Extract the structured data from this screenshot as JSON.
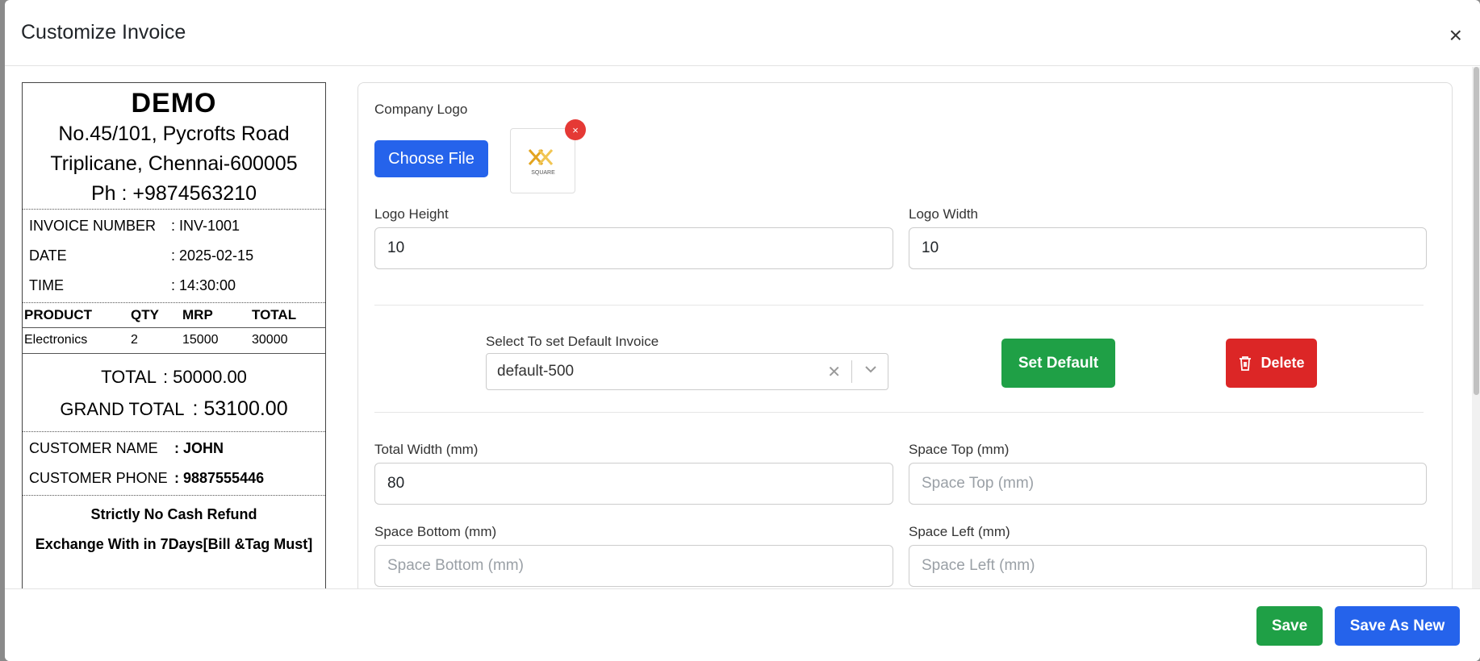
{
  "modal": {
    "title": "Customize Invoice",
    "close_glyph": "×"
  },
  "receipt": {
    "company": "DEMO",
    "address1": "No.45/101, Pycrofts Road",
    "address2": "Triplicane, Chennai-600005",
    "phone": "Ph : +9874563210",
    "info": [
      {
        "k": "INVOICE NUMBER",
        "v": ": INV-1001"
      },
      {
        "k": "DATE",
        "v": ": 2025-02-15"
      },
      {
        "k": "TIME",
        "v": ": 14:30:00"
      }
    ],
    "table": {
      "headers": [
        "PRODUCT",
        "QTY",
        "MRP",
        "TOTAL"
      ],
      "rows": [
        [
          "Electronics",
          "2",
          "15000",
          "30000"
        ]
      ]
    },
    "total_label": "TOTAL",
    "total_value": ": 50000.00",
    "grand_total_label": "GRAND TOTAL",
    "grand_total_value": ": 53100.00",
    "customer": [
      {
        "k": "CUSTOMER NAME",
        "v": ": JOHN"
      },
      {
        "k": "CUSTOMER PHONE",
        "v": ": 9887555446"
      }
    ],
    "notes": [
      "Strictly No Cash Refund",
      "Exchange With in 7Days[Bill &Tag Must]"
    ]
  },
  "form": {
    "company_logo_label": "Company Logo",
    "choose_file_label": "Choose File",
    "logo_remove_glyph": "×",
    "logo_text": "SQUARE",
    "logo_height_label": "Logo Height",
    "logo_height_value": "10",
    "logo_width_label": "Logo Width",
    "logo_width_value": "10",
    "default_select_label": "Select To set Default Invoice",
    "default_select_value": "default-500",
    "set_default_label": "Set Default",
    "delete_label": "Delete",
    "total_width_label": "Total Width (mm)",
    "total_width_value": "80",
    "space_top_label": "Space Top (mm)",
    "space_top_placeholder": "Space Top (mm)",
    "space_bottom_label": "Space Bottom (mm)",
    "space_bottom_placeholder": "Space Bottom (mm)",
    "space_left_label": "Space Left (mm)",
    "space_left_placeholder": "Space Left (mm)"
  },
  "footer": {
    "save_label": "Save",
    "save_as_new_label": "Save As New"
  },
  "colors": {
    "green": "#1fa046",
    "blue": "#2563eb",
    "red": "#dc2626",
    "logo_gold": "#e3a41f"
  }
}
